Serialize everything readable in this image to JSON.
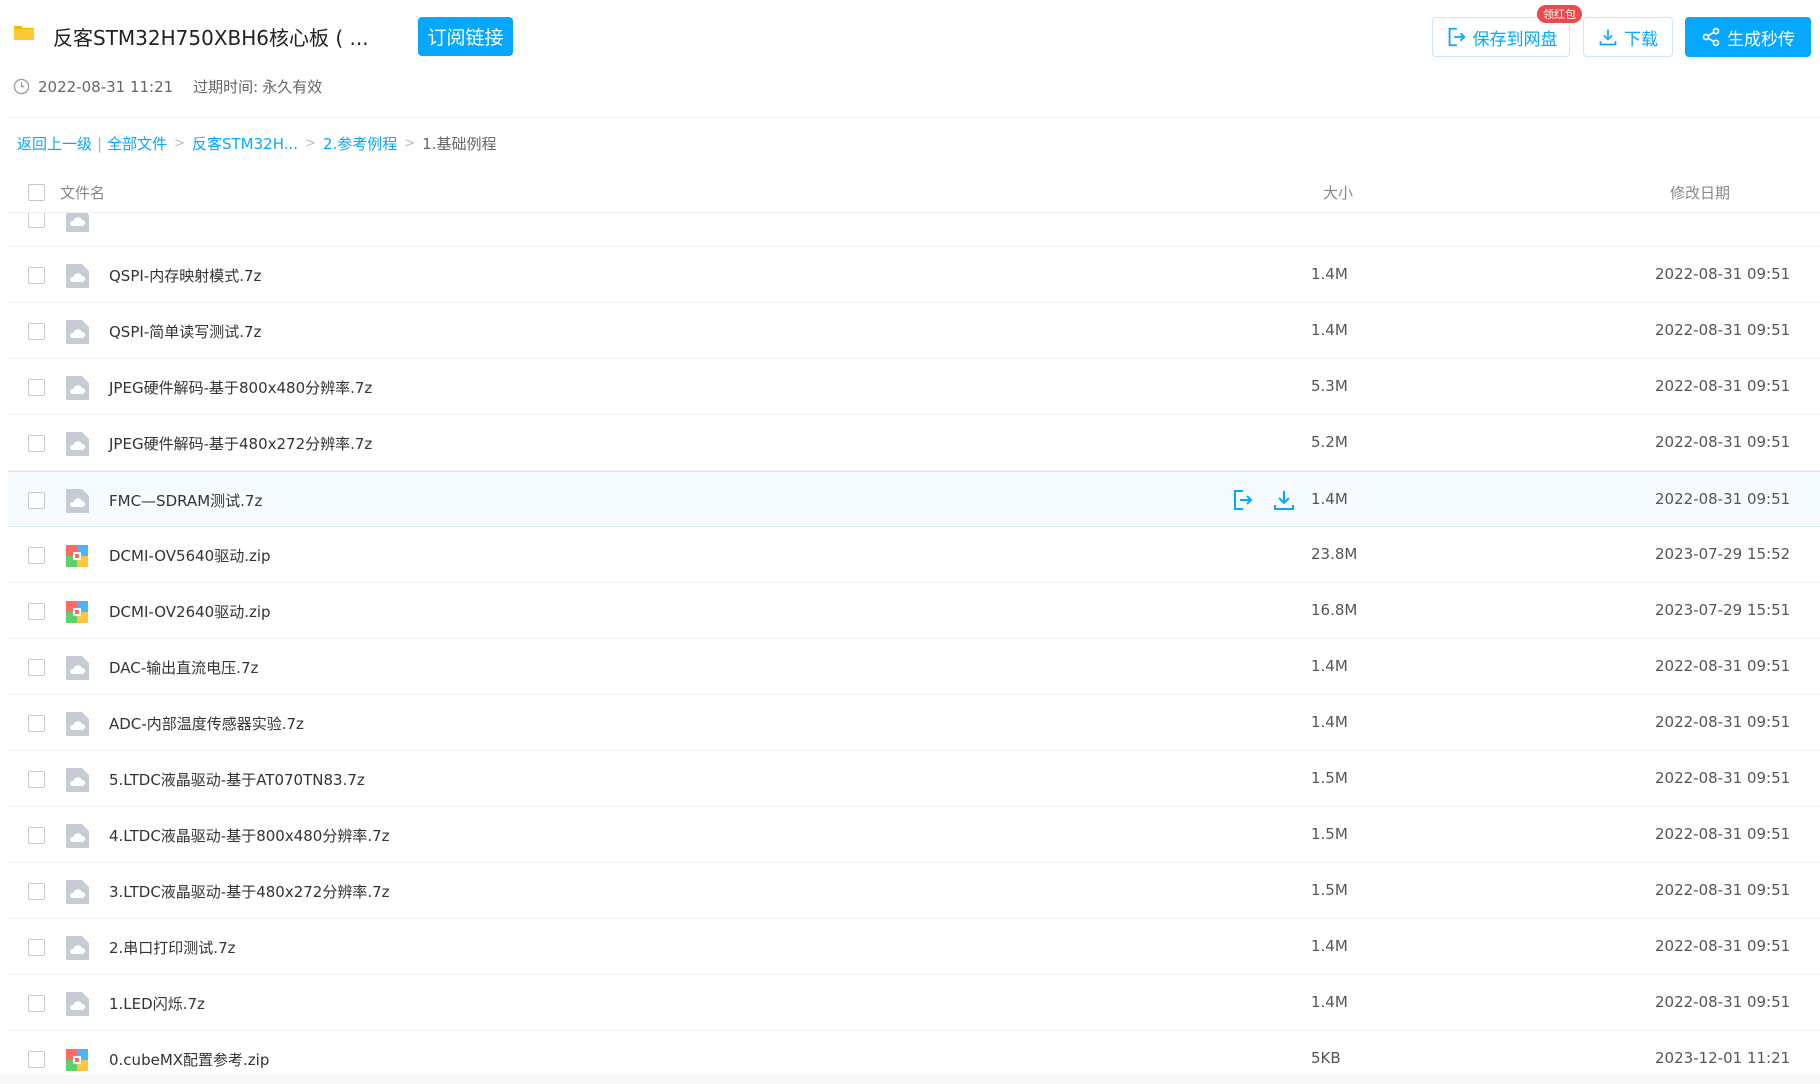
{
  "header": {
    "title": "反客STM32H750XBH6核心板 ( ...",
    "subscribe_label": "订阅链接",
    "created": "2022-08-31 11:21",
    "expire_label": "过期时间:",
    "expire_value": "永久有效",
    "save_label": "保存到网盘",
    "save_badge": "领红包",
    "download_label": "下载",
    "share_label": "生成秒传"
  },
  "breadcrumb": {
    "back": "返回上一级",
    "separator": "|",
    "items": [
      "全部文件",
      "反客STM32H...",
      "2.参考例程"
    ],
    "current": "1.基础例程"
  },
  "columns": {
    "name": "文件名",
    "size": "大小",
    "date": "修改日期"
  },
  "files": [
    {
      "name": "",
      "size": "",
      "date": "",
      "type": "7z"
    },
    {
      "name": "QSPI-内存映射模式.7z",
      "size": "1.4M",
      "date": "2022-08-31 09:51",
      "type": "7z"
    },
    {
      "name": "QSPI-简单读写测试.7z",
      "size": "1.4M",
      "date": "2022-08-31 09:51",
      "type": "7z"
    },
    {
      "name": "JPEG硬件解码-基于800x480分辨率.7z",
      "size": "5.3M",
      "date": "2022-08-31 09:51",
      "type": "7z"
    },
    {
      "name": "JPEG硬件解码-基于480x272分辨率.7z",
      "size": "5.2M",
      "date": "2022-08-31 09:51",
      "type": "7z"
    },
    {
      "name": "FMC—SDRAM测试.7z",
      "size": "1.4M",
      "date": "2022-08-31 09:51",
      "type": "7z",
      "hover": true
    },
    {
      "name": "DCMI-OV5640驱动.zip",
      "size": "23.8M",
      "date": "2023-07-29 15:52",
      "type": "zip"
    },
    {
      "name": "DCMI-OV2640驱动.zip",
      "size": "16.8M",
      "date": "2023-07-29 15:51",
      "type": "zip"
    },
    {
      "name": "DAC-输出直流电压.7z",
      "size": "1.4M",
      "date": "2022-08-31 09:51",
      "type": "7z"
    },
    {
      "name": "ADC-内部温度传感器实验.7z",
      "size": "1.4M",
      "date": "2022-08-31 09:51",
      "type": "7z"
    },
    {
      "name": "5.LTDC液晶驱动-基于AT070TN83.7z",
      "size": "1.5M",
      "date": "2022-08-31 09:51",
      "type": "7z"
    },
    {
      "name": "4.LTDC液晶驱动-基于800x480分辨率.7z",
      "size": "1.5M",
      "date": "2022-08-31 09:51",
      "type": "7z"
    },
    {
      "name": "3.LTDC液晶驱动-基于480x272分辨率.7z",
      "size": "1.5M",
      "date": "2022-08-31 09:51",
      "type": "7z"
    },
    {
      "name": "2.串口打印测试.7z",
      "size": "1.4M",
      "date": "2022-08-31 09:51",
      "type": "7z"
    },
    {
      "name": "1.LED闪烁.7z",
      "size": "1.4M",
      "date": "2022-08-31 09:51",
      "type": "7z"
    },
    {
      "name": "0.cubeMX配置参考.zip",
      "size": "5KB",
      "date": "2023-12-01 11:21",
      "type": "zip"
    }
  ],
  "colors": {
    "accent": "#06a7ff",
    "badge": "#f0484a",
    "icon_gray": "#c5ccd6"
  },
  "icons": {
    "folder": "folder-icon",
    "clock": "clock-icon",
    "save": "save-to-cloud-icon",
    "download": "download-icon",
    "share": "share-icon",
    "file_7z": "compressed-file-icon",
    "file_zip": "zip-archive-icon"
  }
}
